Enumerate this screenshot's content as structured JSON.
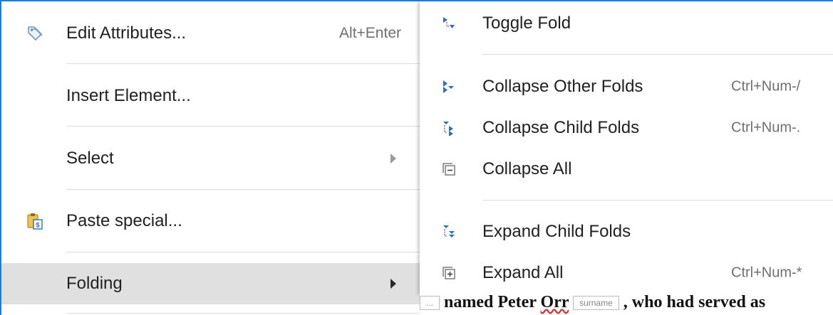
{
  "main_menu": {
    "items": [
      {
        "label": "Edit Attributes...",
        "shortcut": "Alt+Enter",
        "icon": "tag-icon"
      },
      {
        "label": "Insert Element...",
        "shortcut": ""
      },
      {
        "label": "Select",
        "shortcut": "",
        "submenu": true
      },
      {
        "label": "Paste special...",
        "shortcut": "",
        "icon": "clipboard-icon"
      },
      {
        "label": "Folding",
        "shortcut": "",
        "submenu": true,
        "active": true
      }
    ]
  },
  "folding_menu": {
    "items": [
      {
        "label": "Toggle Fold",
        "shortcut": "",
        "icon": "toggle-fold-icon"
      },
      {
        "label": "Collapse Other Folds",
        "shortcut": "Ctrl+Num-/",
        "icon": "collapse-other-icon"
      },
      {
        "label": "Collapse Child Folds",
        "shortcut": "Ctrl+Num-.",
        "icon": "collapse-child-icon"
      },
      {
        "label": "Collapse All",
        "shortcut": "",
        "icon": "collapse-all-icon"
      },
      {
        "label": "Expand Child Folds",
        "shortcut": "",
        "icon": "expand-child-icon"
      },
      {
        "label": "Expand All",
        "shortcut": "Ctrl+Num-*",
        "icon": "expand-all-icon"
      }
    ]
  },
  "document": {
    "prefix": "...",
    "text_before": " named Peter ",
    "underlined_word": "Orr",
    "tag_label": "surname",
    "text_after": " , who had served as"
  },
  "colors": {
    "accent": "#1b7fd1",
    "active_row": "#e0e0e0",
    "shortcut_text": "#6f6f6f",
    "fold_icon_blue": "#2a6fb8"
  }
}
